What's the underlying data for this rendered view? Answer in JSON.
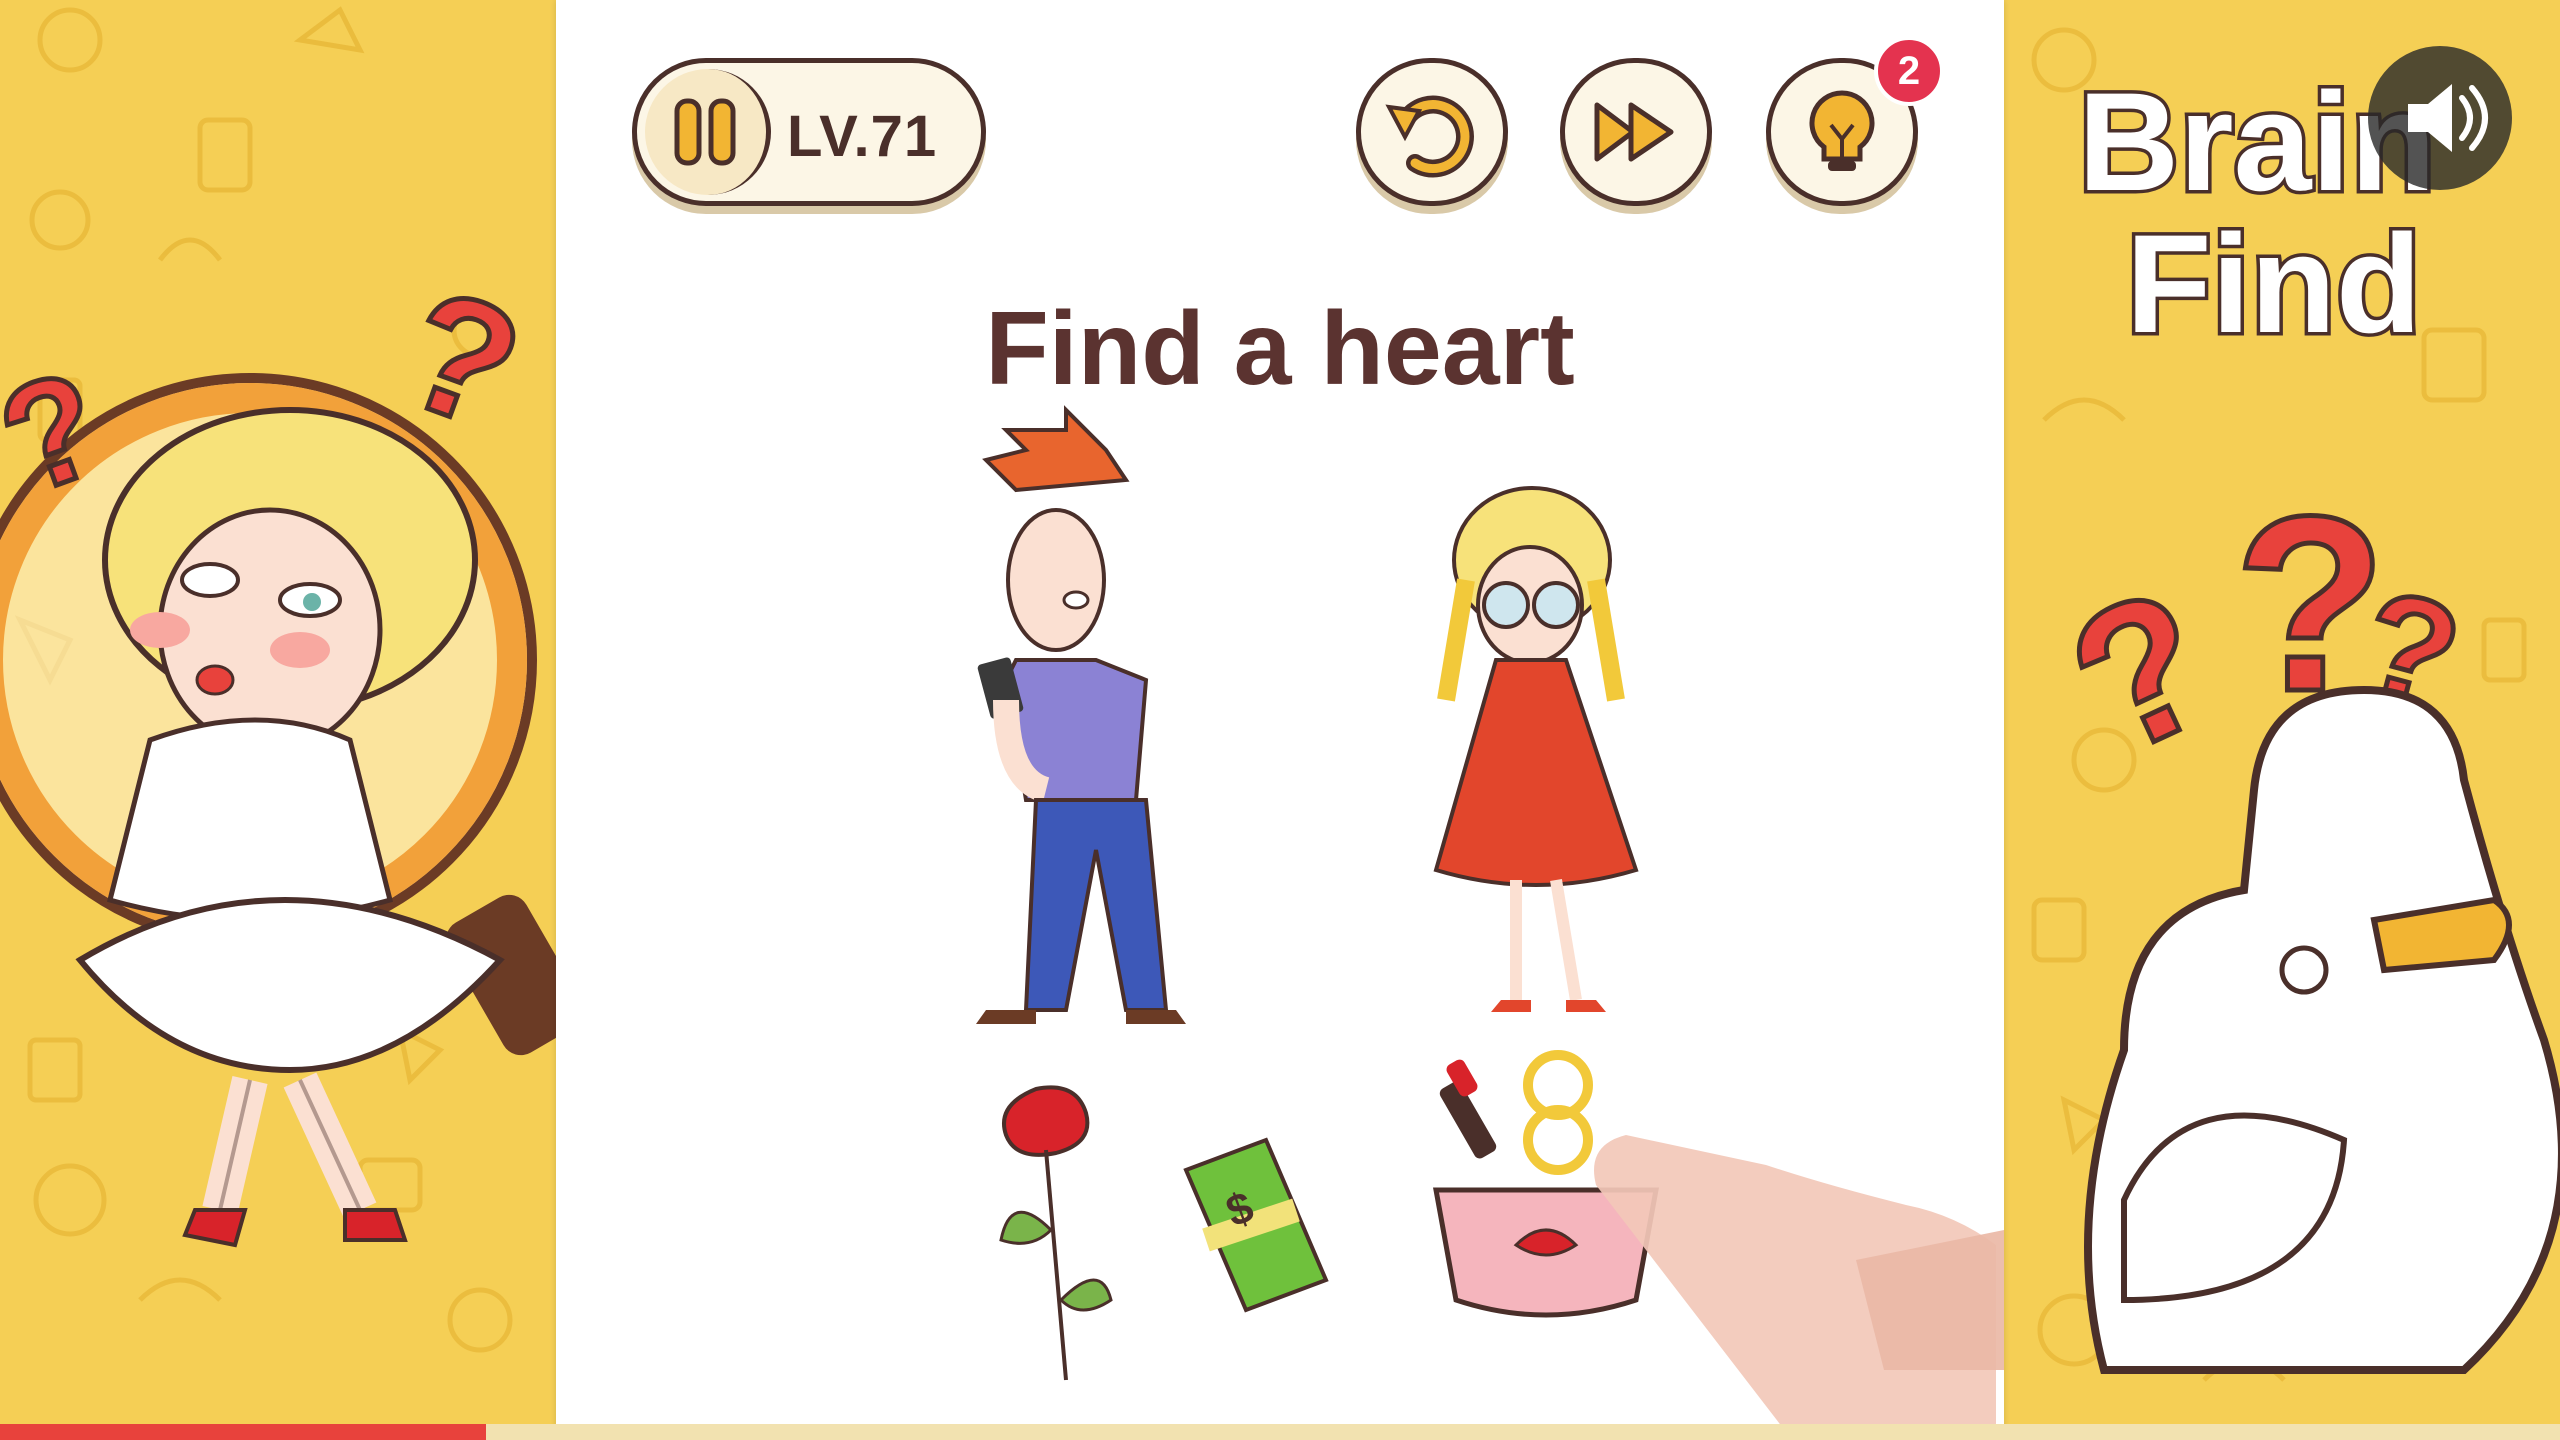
{
  "game": {
    "level_label": "LV.71",
    "hint_count": "2",
    "prompt": "Find a heart",
    "logo_line1": "Brain",
    "logo_line2": "Find"
  },
  "icons": {
    "pause": "pause-icon",
    "restart": "restart-icon",
    "skip": "fast-forward-icon",
    "hint": "lightbulb-icon",
    "sound": "speaker-icon"
  },
  "colors": {
    "background": "#f5cf55",
    "board": "#ffffff",
    "text": "#5b3330",
    "badge": "#e4334f",
    "progress": "#e8423c"
  },
  "progress": {
    "fraction": 0.19
  }
}
